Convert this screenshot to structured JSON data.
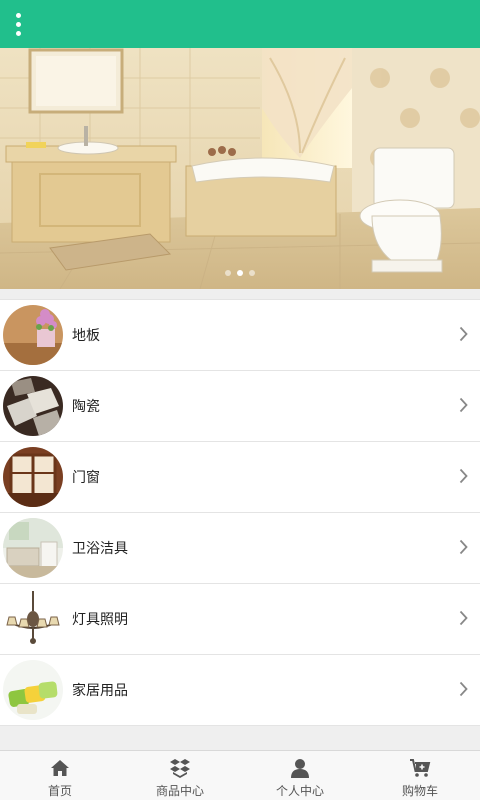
{
  "header": {
    "menu_icon": "more-vertical-icon",
    "background_color": "#21bf8c"
  },
  "banner": {
    "slide_count": 3,
    "active_slide_index": 1
  },
  "categories": [
    {
      "label": "地板",
      "thumb": "flower-pot"
    },
    {
      "label": "陶瓷",
      "thumb": "tiles"
    },
    {
      "label": "门窗",
      "thumb": "window"
    },
    {
      "label": "卫浴洁具",
      "thumb": "bathroom"
    },
    {
      "label": "灯具照明",
      "thumb": "chandelier"
    },
    {
      "label": "家居用品",
      "thumb": "sponges"
    }
  ],
  "tabbar": {
    "items": [
      {
        "label": "首页",
        "icon": "home-icon"
      },
      {
        "label": "商品中心",
        "icon": "box-icon"
      },
      {
        "label": "个人中心",
        "icon": "user-icon"
      },
      {
        "label": "购物车",
        "icon": "cart-icon"
      }
    ]
  }
}
